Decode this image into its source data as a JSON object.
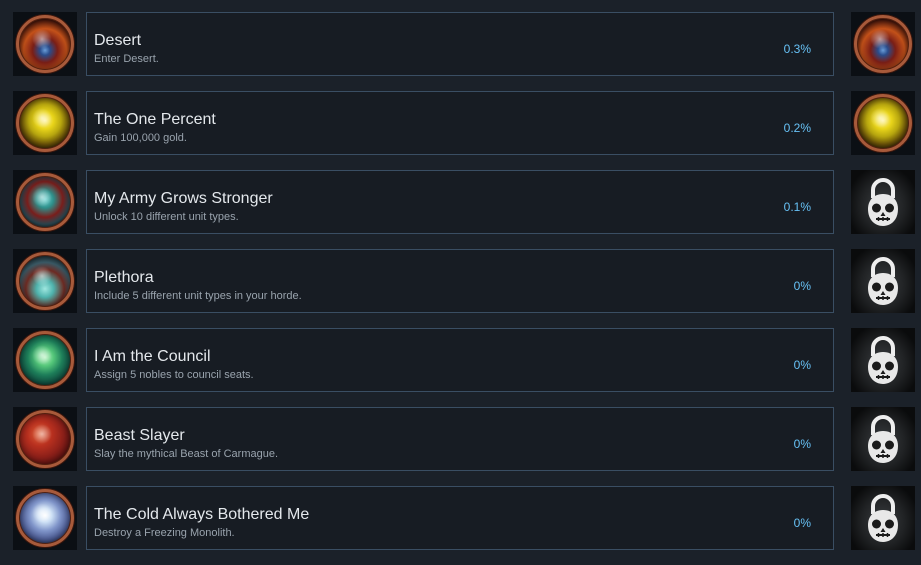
{
  "achievements": [
    {
      "title": "Desert",
      "description": "Enter Desert.",
      "percent": "0.3%",
      "unlocked": true,
      "icon": "desert-achievement-icon"
    },
    {
      "title": "The One Percent",
      "description": "Gain 100,000 gold.",
      "percent": "0.2%",
      "unlocked": true,
      "icon": "gold-treasure-achievement-icon"
    },
    {
      "title": "My Army Grows Stronger",
      "description": "Unlock 10 different unit types.",
      "percent": "0.1%",
      "unlocked": false,
      "icon": "army-achievement-icon"
    },
    {
      "title": "Plethora",
      "description": "Include 5 different unit types in your horde.",
      "percent": "0%",
      "unlocked": false,
      "icon": "horde-achievement-icon"
    },
    {
      "title": "I Am the Council",
      "description": "Assign 5 nobles to council seats.",
      "percent": "0%",
      "unlocked": false,
      "icon": "council-achievement-icon"
    },
    {
      "title": "Beast Slayer",
      "description": "Slay the mythical Beast of Carmague.",
      "percent": "0%",
      "unlocked": false,
      "icon": "beast-achievement-icon"
    },
    {
      "title": "The Cold Always Bothered Me",
      "description": "Destroy a Freezing Monolith.",
      "percent": "0%",
      "unlocked": false,
      "icon": "ice-monolith-achievement-icon"
    }
  ],
  "colors": {
    "background": "#1b2129",
    "row_border": "#3a4e63",
    "title_text": "#e4e8ec",
    "description_text": "#99a3ad",
    "percent_text": "#67c1f5",
    "medal_rim": "#a85a3a"
  }
}
